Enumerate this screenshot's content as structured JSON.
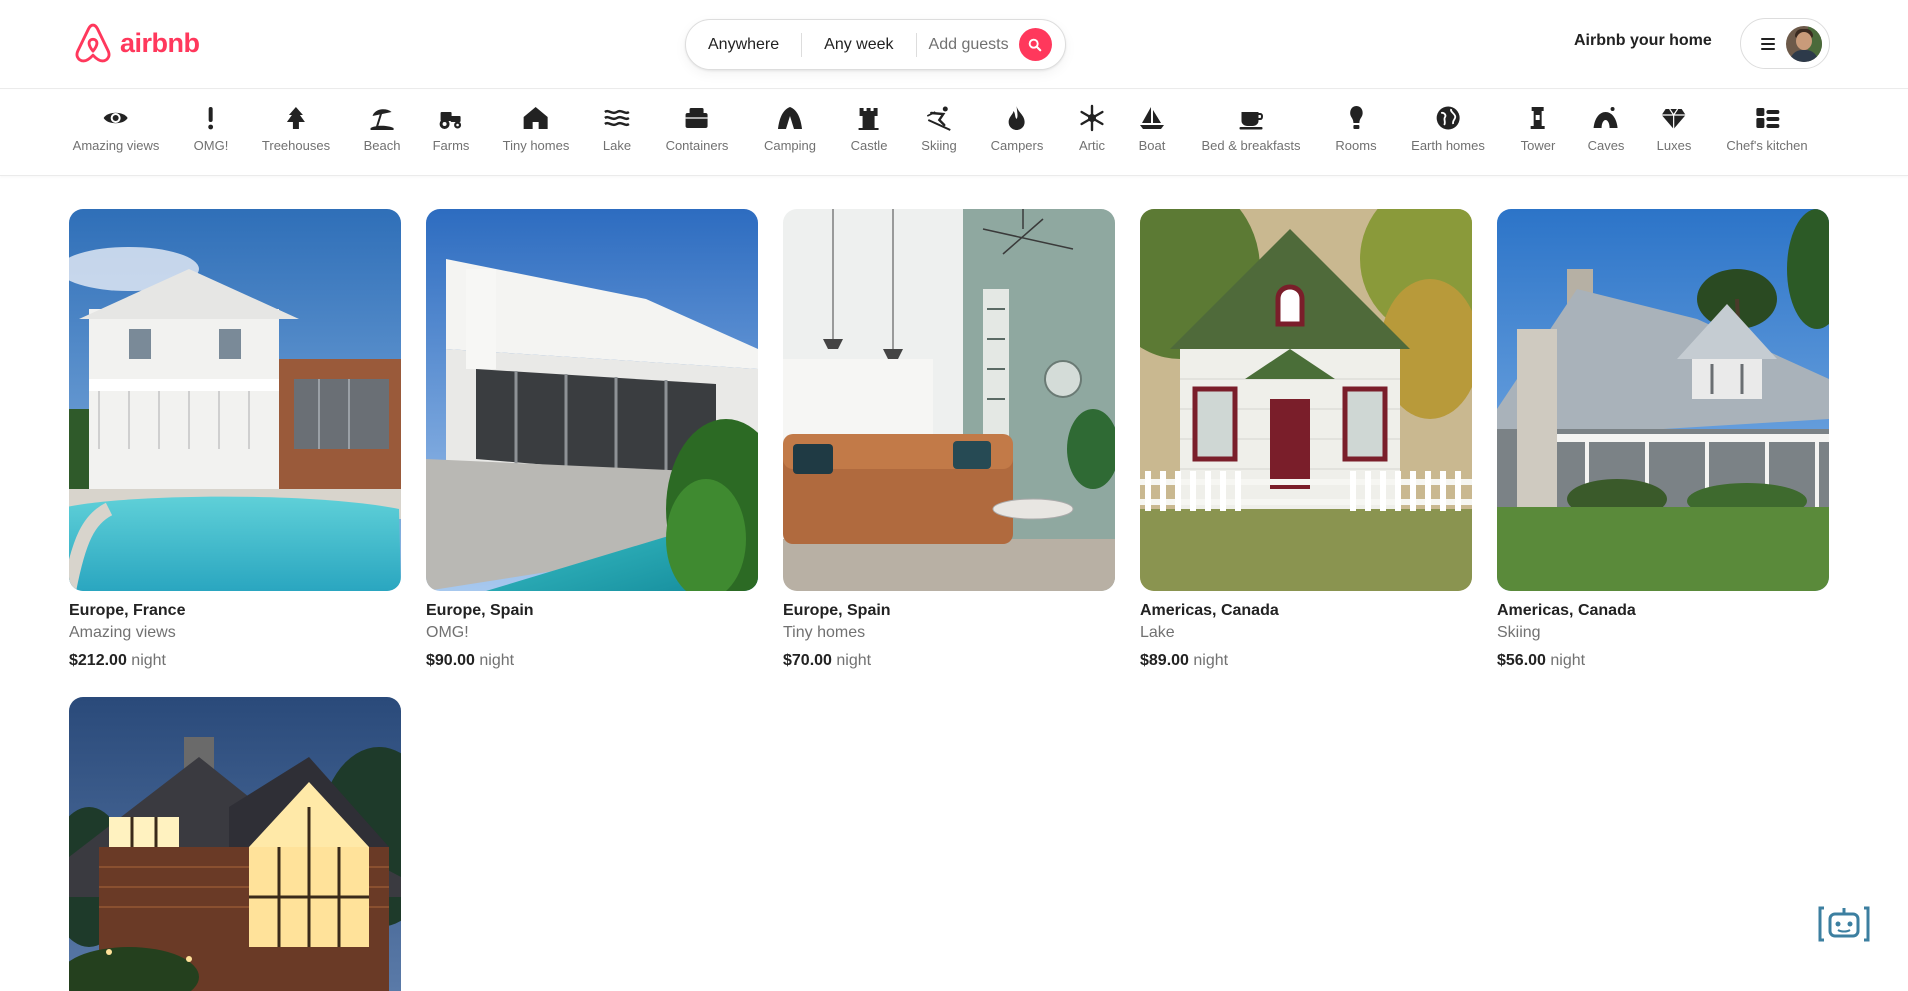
{
  "brand": {
    "name": "airbnb",
    "color": "#ff385c"
  },
  "search": {
    "where": "Anywhere",
    "when": "Any week",
    "guests_placeholder": "Add guests"
  },
  "header": {
    "host_link": "Airbnb your home"
  },
  "categories": [
    {
      "label": "Amazing views",
      "icon": "eye-icon"
    },
    {
      "label": "OMG!",
      "icon": "exclamation-icon"
    },
    {
      "label": "Treehouses",
      "icon": "tree-icon"
    },
    {
      "label": "Beach",
      "icon": "beach-umbrella-icon"
    },
    {
      "label": "Farms",
      "icon": "tractor-icon"
    },
    {
      "label": "Tiny homes",
      "icon": "house-icon"
    },
    {
      "label": "Lake",
      "icon": "waves-icon"
    },
    {
      "label": "Containers",
      "icon": "container-icon"
    },
    {
      "label": "Camping",
      "icon": "tent-icon"
    },
    {
      "label": "Castle",
      "icon": "castle-icon"
    },
    {
      "label": "Skiing",
      "icon": "skier-icon"
    },
    {
      "label": "Campers",
      "icon": "fire-icon"
    },
    {
      "label": "Artic",
      "icon": "snowflake-icon"
    },
    {
      "label": "Boat",
      "icon": "sailboat-icon"
    },
    {
      "label": "Bed & breakfasts",
      "icon": "coffee-cup-icon"
    },
    {
      "label": "Rooms",
      "icon": "lamp-icon"
    },
    {
      "label": "Earth homes",
      "icon": "globe-icon"
    },
    {
      "label": "Tower",
      "icon": "tower-icon"
    },
    {
      "label": "Caves",
      "icon": "cave-icon"
    },
    {
      "label": "Luxes",
      "icon": "diamond-icon"
    },
    {
      "label": "Chef's kitchen",
      "icon": "stove-icon"
    }
  ],
  "listings": [
    {
      "location": "Europe, France",
      "category": "Amazing views",
      "price": "$212.00",
      "unit": "night"
    },
    {
      "location": "Europe, Spain",
      "category": "OMG!",
      "price": "$90.00",
      "unit": "night"
    },
    {
      "location": "Europe, Spain",
      "category": "Tiny homes",
      "price": "$70.00",
      "unit": "night"
    },
    {
      "location": "Americas, Canada",
      "category": "Lake",
      "price": "$89.00",
      "unit": "night"
    },
    {
      "location": "Americas, Canada",
      "category": "Skiing",
      "price": "$56.00",
      "unit": "night"
    },
    {
      "location": "",
      "category": "",
      "price": "",
      "unit": ""
    }
  ]
}
